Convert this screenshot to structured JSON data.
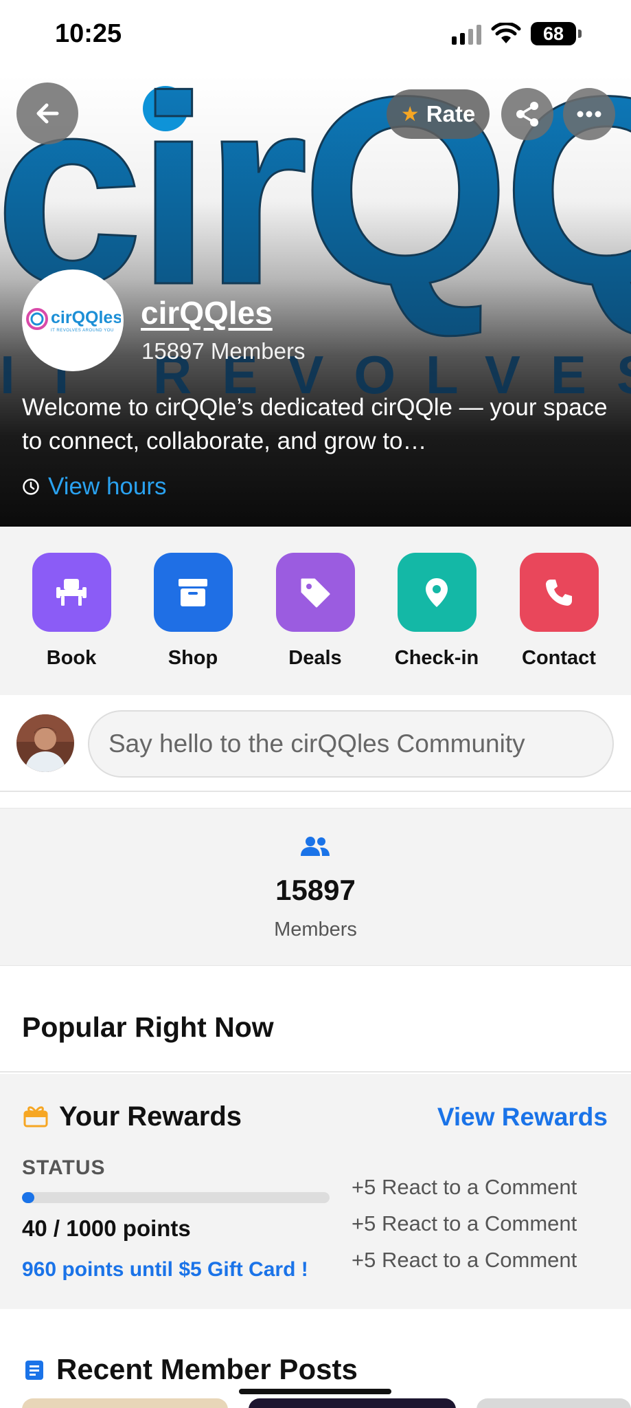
{
  "status_bar": {
    "time": "10:25",
    "battery": "68",
    "icons": [
      "cellular-signal-icon",
      "wifi-icon",
      "battery-icon"
    ]
  },
  "hero": {
    "rate_label": "Rate",
    "community_name": "cirQQles",
    "member_count_text": "15897 Members",
    "description": "Welcome to cirQQle’s dedicated cirQQle — your space to connect, collaborate, and grow to…",
    "view_hours_label": "View hours",
    "logo_text": "cirQQles",
    "logo_tagline": "IT REVOLVES AROUND YOU",
    "banner_text": "cirQQ",
    "banner_tagline": "IT REVOLVES A"
  },
  "actions": [
    {
      "label": "Book",
      "icon": "seat-icon",
      "color": "#8b5cf6"
    },
    {
      "label": "Shop",
      "icon": "store-box-icon",
      "color": "#1f6fe5"
    },
    {
      "label": "Deals",
      "icon": "tag-icon",
      "color": "#9b5ce0"
    },
    {
      "label": "Check-in",
      "icon": "location-pin-icon",
      "color": "#14b8a6"
    },
    {
      "label": "Contact",
      "icon": "phone-icon",
      "color": "#e9475b"
    }
  ],
  "composer": {
    "placeholder": "Say hello to the cirQQles Community"
  },
  "members_stat": {
    "number": "15897",
    "label": "Members"
  },
  "popular": {
    "title": "Popular Right Now"
  },
  "rewards": {
    "title": "Your Rewards",
    "view_label": "View Rewards",
    "status_label": "STATUS",
    "progress_fraction": 0.04,
    "points_text": "40 / 1000 points",
    "until_text": "960 points until $5 Gift Card !",
    "items": [
      "+5 React to a Comment",
      "+5 React to a Comment",
      "+5 React to a Comment"
    ]
  },
  "recent_posts": {
    "title": "Recent Member Posts"
  },
  "colors": {
    "accent_blue": "#1a73e8",
    "link_blue": "#2aa2f0",
    "gift_orange": "#f6a623"
  }
}
